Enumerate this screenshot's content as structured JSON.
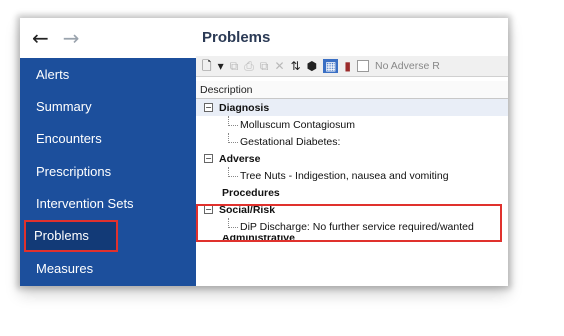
{
  "nav": {
    "back_glyph": "←",
    "forward_glyph": "→"
  },
  "sidebar": {
    "items": [
      {
        "label": "Alerts"
      },
      {
        "label": "Summary"
      },
      {
        "label": "Encounters"
      },
      {
        "label": "Prescriptions"
      },
      {
        "label": "Intervention Sets"
      },
      {
        "label": "Problems",
        "selected": true
      },
      {
        "label": "Measures"
      }
    ]
  },
  "panel": {
    "title": "Problems",
    "toolbar": {
      "new_glyph": "🗋",
      "dropdown_glyph": "▾",
      "copy_glyph": "⧉",
      "print_glyph": "⎙",
      "paste_glyph": "⧉",
      "delete_glyph": "✕",
      "refresh_glyph": "⇅",
      "cube_glyph": "⬢",
      "view_glyph": "▦",
      "book_glyph": "▮",
      "no_adverse_label": "No Adverse R"
    },
    "column_header": "Description",
    "collapse_glyph": "−",
    "groups": [
      {
        "label": "Diagnosis",
        "items": [
          "Molluscum Contagiosum",
          "Gestational Diabetes:"
        ]
      },
      {
        "label": "Adverse",
        "items": [
          "Tree Nuts - Indigestion, nausea and vomiting"
        ]
      },
      {
        "label": "Procedures",
        "items": []
      },
      {
        "label": "Social/Risk",
        "items": [
          "DiP Discharge: No further service required/wanted"
        ]
      },
      {
        "label": "Administrative",
        "items": []
      }
    ]
  },
  "colors": {
    "sidebar_bg": "#1c4f9c",
    "selected_bg": "#123a77",
    "highlight_border": "#e0312d"
  }
}
